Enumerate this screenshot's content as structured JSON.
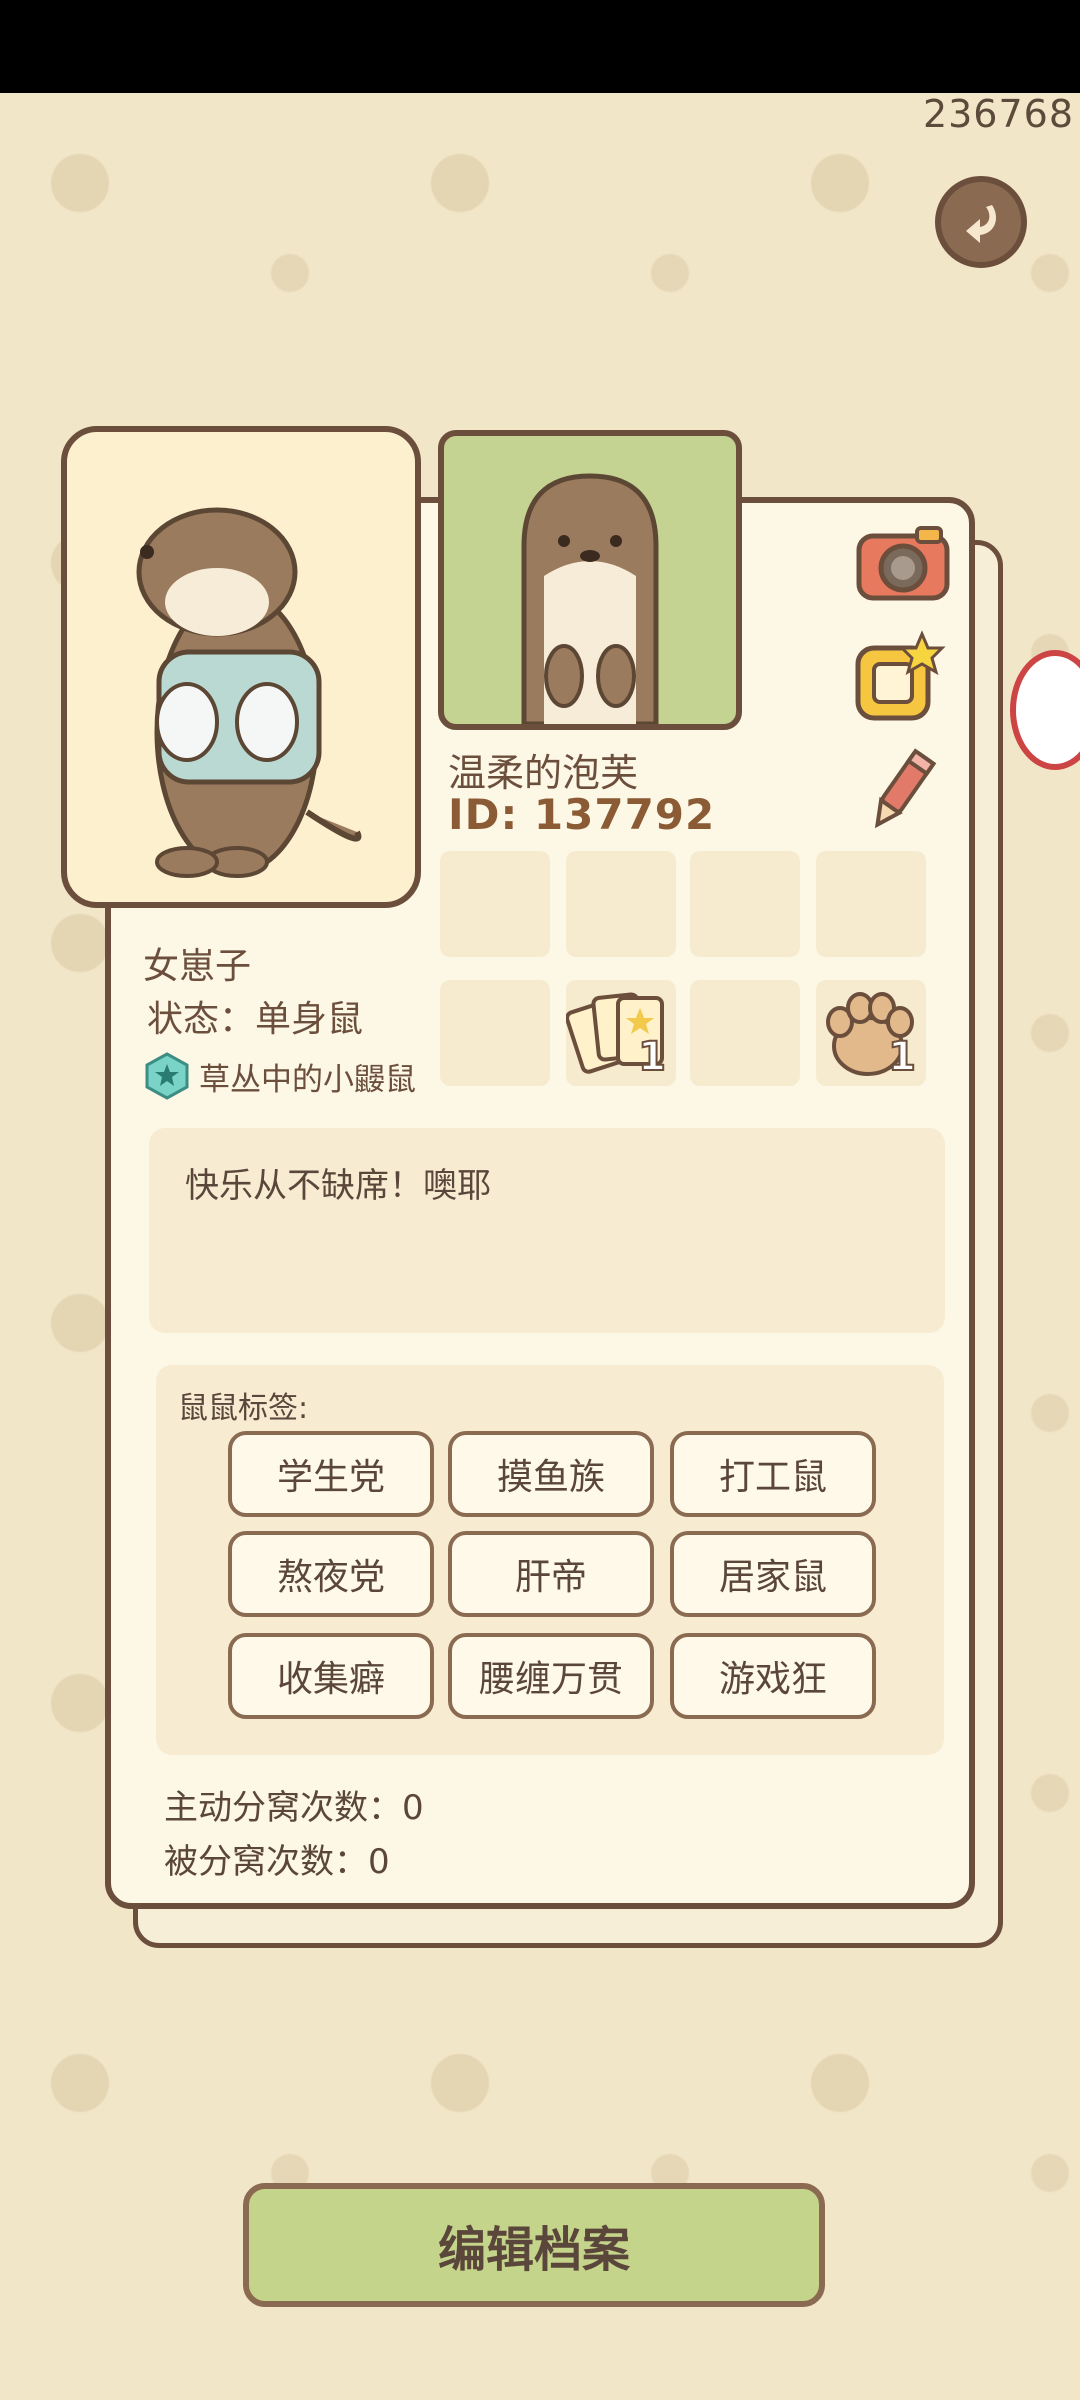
{
  "header": {
    "counter": "236768"
  },
  "profile": {
    "nickname": "温柔的泡芙",
    "id_text": "ID: 137792",
    "gender": "女崽子",
    "status": "状态：单身鼠",
    "title_badge": "草丛中的小鼹鼠",
    "signature": "快乐从不缺席！噢耶"
  },
  "items": {
    "cards_count": "1",
    "paw_count": "1"
  },
  "tags": {
    "label": "鼠鼠标签:",
    "items": [
      "学生党",
      "摸鱼族",
      "打工鼠",
      "熬夜党",
      "肝帝",
      "居家鼠",
      "收集癖",
      "腰缠万贯",
      "游戏狂"
    ]
  },
  "breakups": {
    "active": "主动分窝次数：0",
    "passive": "被分窝次数：0"
  },
  "actions": {
    "edit": "编辑档案"
  }
}
